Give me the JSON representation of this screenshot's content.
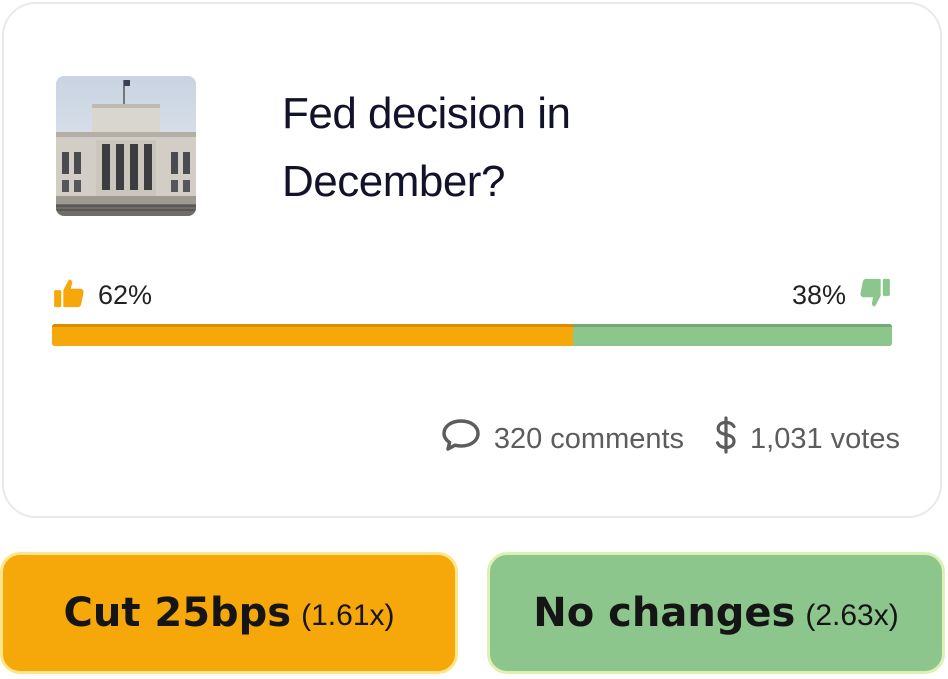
{
  "poll": {
    "image_subject": "federal-reserve-building",
    "title_line1": "Fed decision in",
    "title_line2": "December?",
    "yes_percent": 62,
    "no_percent": 38,
    "yes_percent_label": "62%",
    "no_percent_label": "38%",
    "comments_label": "320 comments",
    "votes_label": "1,031 votes"
  },
  "options": [
    {
      "label": "Cut 25bps",
      "odds": "(1.61x)"
    },
    {
      "label": "No changes",
      "odds": "(2.63x)"
    }
  ],
  "colors": {
    "yes": "#f6a70a",
    "no": "#8cc68c",
    "title": "#12122a",
    "muted": "#5c5c5c"
  },
  "icons": {
    "thumbs_up": "thumbs-up-icon",
    "thumbs_down": "thumbs-down-icon",
    "comments": "chat-bubble-icon",
    "votes": "dollar-icon"
  }
}
